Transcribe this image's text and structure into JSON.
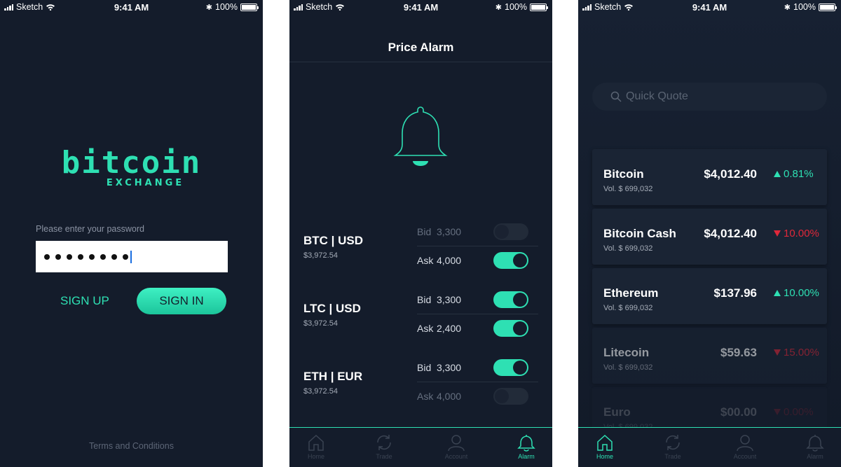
{
  "status": {
    "carrier": "Sketch",
    "time": "9:41 AM",
    "battery": "100%"
  },
  "login": {
    "logo_word": "bitcoin",
    "logo_sub": "EXCHANGE",
    "password_label": "Please enter your password",
    "password_masked": "••••••••",
    "signup_label": "SIGN UP",
    "signin_label": "SIGN IN",
    "terms_label": "Terms and Conditions"
  },
  "alarm": {
    "title": "Price Alarm",
    "pairs": [
      {
        "name": "BTC | USD",
        "price": "$3,972.54",
        "bid_label": "Bid",
        "bid_value": "3,300",
        "bid_on": false,
        "ask_label": "Ask",
        "ask_value": "4,000",
        "ask_on": true
      },
      {
        "name": "LTC | USD",
        "price": "$3,972.54",
        "bid_label": "Bid",
        "bid_value": "3,300",
        "bid_on": true,
        "ask_label": "Ask",
        "ask_value": "2,400",
        "ask_on": true
      },
      {
        "name": "ETH | EUR",
        "price": "$3,972.54",
        "bid_label": "Bid",
        "bid_value": "3,300",
        "bid_on": true,
        "ask_label": "Ask",
        "ask_value": "4,000",
        "ask_on": false
      }
    ],
    "tabs": [
      "Home",
      "Trade",
      "Account",
      "Alarm"
    ],
    "active_tab": "Alarm"
  },
  "quotes": {
    "search_placeholder": "Quick Quote",
    "items": [
      {
        "name": "Bitcoin",
        "volume": "Vol. $ 699,032",
        "price": "$4,012.40",
        "change": "0.81%",
        "direction": "up"
      },
      {
        "name": "Bitcoin Cash",
        "volume": "Vol. $ 699,032",
        "price": "$4,012.40",
        "change": "10.00%",
        "direction": "down"
      },
      {
        "name": "Ethereum",
        "volume": "Vol. $ 699,032",
        "price": "$137.96",
        "change": "10.00%",
        "direction": "up"
      },
      {
        "name": "Litecoin",
        "volume": "Vol. $ 699,032",
        "price": "$59.63",
        "change": "15.00%",
        "direction": "down"
      },
      {
        "name": "Euro",
        "volume": "Vol. $ 699,032",
        "price": "$00.00",
        "change": "0.00%",
        "direction": "down"
      }
    ],
    "tabs": [
      "Home",
      "Trade",
      "Account",
      "Alarm"
    ],
    "active_tab": "Home"
  },
  "colors": {
    "accent": "#2ee0b3",
    "down": "#e0283a",
    "background": "#141c2b"
  }
}
